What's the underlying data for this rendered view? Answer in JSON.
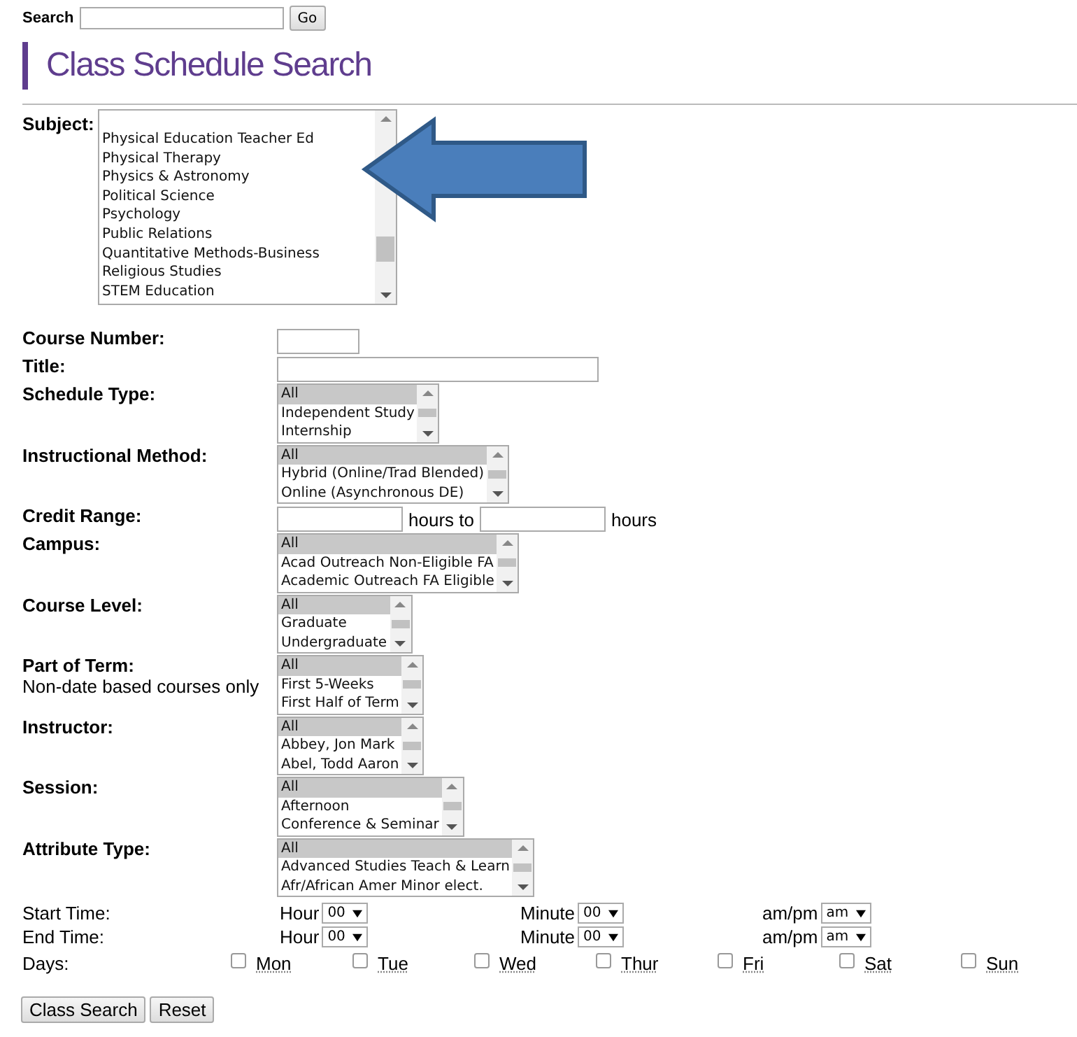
{
  "search": {
    "label": "Search",
    "button": "Go"
  },
  "title": "Class Schedule Search",
  "subject": {
    "label": "Subject:",
    "options": [
      {
        "text": "Physical Education Teacher Ed",
        "selected": false
      },
      {
        "text": "Physical Therapy",
        "selected": false
      },
      {
        "text": "Physics & Astronomy",
        "selected": false
      },
      {
        "text": "Political Science",
        "selected": false
      },
      {
        "text": "Psychology",
        "selected": false
      },
      {
        "text": "Public Relations",
        "selected": false
      },
      {
        "text": "Quantitative Methods-Business",
        "selected": false
      },
      {
        "text": "Religious Studies",
        "selected": false
      },
      {
        "text": "STEM Education",
        "selected": false
      }
    ]
  },
  "fields": [
    {
      "kind": "short_text",
      "label": "Course Number:"
    },
    {
      "kind": "long_text",
      "label": "Title:"
    },
    {
      "kind": "list",
      "label": "Schedule Type:",
      "options": [
        {
          "text": "All",
          "selected": true
        },
        {
          "text": "Independent Study",
          "selected": false
        },
        {
          "text": "Internship",
          "selected": false
        }
      ]
    },
    {
      "kind": "list",
      "label": "Instructional Method:",
      "options": [
        {
          "text": "All",
          "selected": true
        },
        {
          "text": "Hybrid (Online/Trad Blended)",
          "selected": false
        },
        {
          "text": "Online (Asynchronous DE)",
          "selected": false
        }
      ]
    },
    {
      "kind": "range",
      "label": "Credit Range:",
      "between": "hours to",
      "after": "hours"
    },
    {
      "kind": "list",
      "label": "Campus:",
      "options": [
        {
          "text": "All",
          "selected": true
        },
        {
          "text": "Acad Outreach Non-Eligible FA",
          "selected": false
        },
        {
          "text": "Academic Outreach FA Eligible",
          "selected": false
        }
      ]
    },
    {
      "kind": "list",
      "label": "Course Level:",
      "options": [
        {
          "text": "All",
          "selected": true
        },
        {
          "text": "Graduate",
          "selected": false
        },
        {
          "text": "Undergraduate",
          "selected": false
        }
      ]
    },
    {
      "kind": "list",
      "label": "Part of Term:",
      "note": "Non-date based courses only",
      "options": [
        {
          "text": "All",
          "selected": true
        },
        {
          "text": "First 5-Weeks",
          "selected": false
        },
        {
          "text": "First Half of Term",
          "selected": false
        }
      ]
    },
    {
      "kind": "list",
      "label": "Instructor:",
      "options": [
        {
          "text": "All",
          "selected": true
        },
        {
          "text": "Abbey, Jon Mark",
          "selected": false
        },
        {
          "text": "Abel, Todd Aaron",
          "selected": false
        }
      ]
    },
    {
      "kind": "list",
      "label": "Session:",
      "options": [
        {
          "text": "All",
          "selected": true
        },
        {
          "text": "Afternoon",
          "selected": false
        },
        {
          "text": "Conference & Seminar",
          "selected": false
        }
      ]
    },
    {
      "kind": "list",
      "label": "Attribute Type:",
      "options": [
        {
          "text": "All",
          "selected": true
        },
        {
          "text": "Advanced Studies Teach & Learn",
          "selected": false
        },
        {
          "text": "Afr/African Amer Minor elect.",
          "selected": false
        }
      ]
    }
  ],
  "times": [
    {
      "label": "Start Time:",
      "hour_label": "Hour",
      "hour": "00",
      "minute_label": "Minute",
      "minute": "00",
      "ampm_label": "am/pm",
      "ampm": "am"
    },
    {
      "label": "End Time:",
      "hour_label": "Hour",
      "hour": "00",
      "minute_label": "Minute",
      "minute": "00",
      "ampm_label": "am/pm",
      "ampm": "am"
    }
  ],
  "days": {
    "label": "Days:",
    "items": [
      {
        "text": "Mon",
        "checked": false
      },
      {
        "text": "Tue",
        "checked": false
      },
      {
        "text": "Wed",
        "checked": false
      },
      {
        "text": "Thur",
        "checked": false
      },
      {
        "text": "Fri",
        "checked": false
      },
      {
        "text": "Sat",
        "checked": false
      },
      {
        "text": "Sun",
        "checked": false
      }
    ]
  },
  "buttons": [
    "Class Search",
    "Reset"
  ]
}
